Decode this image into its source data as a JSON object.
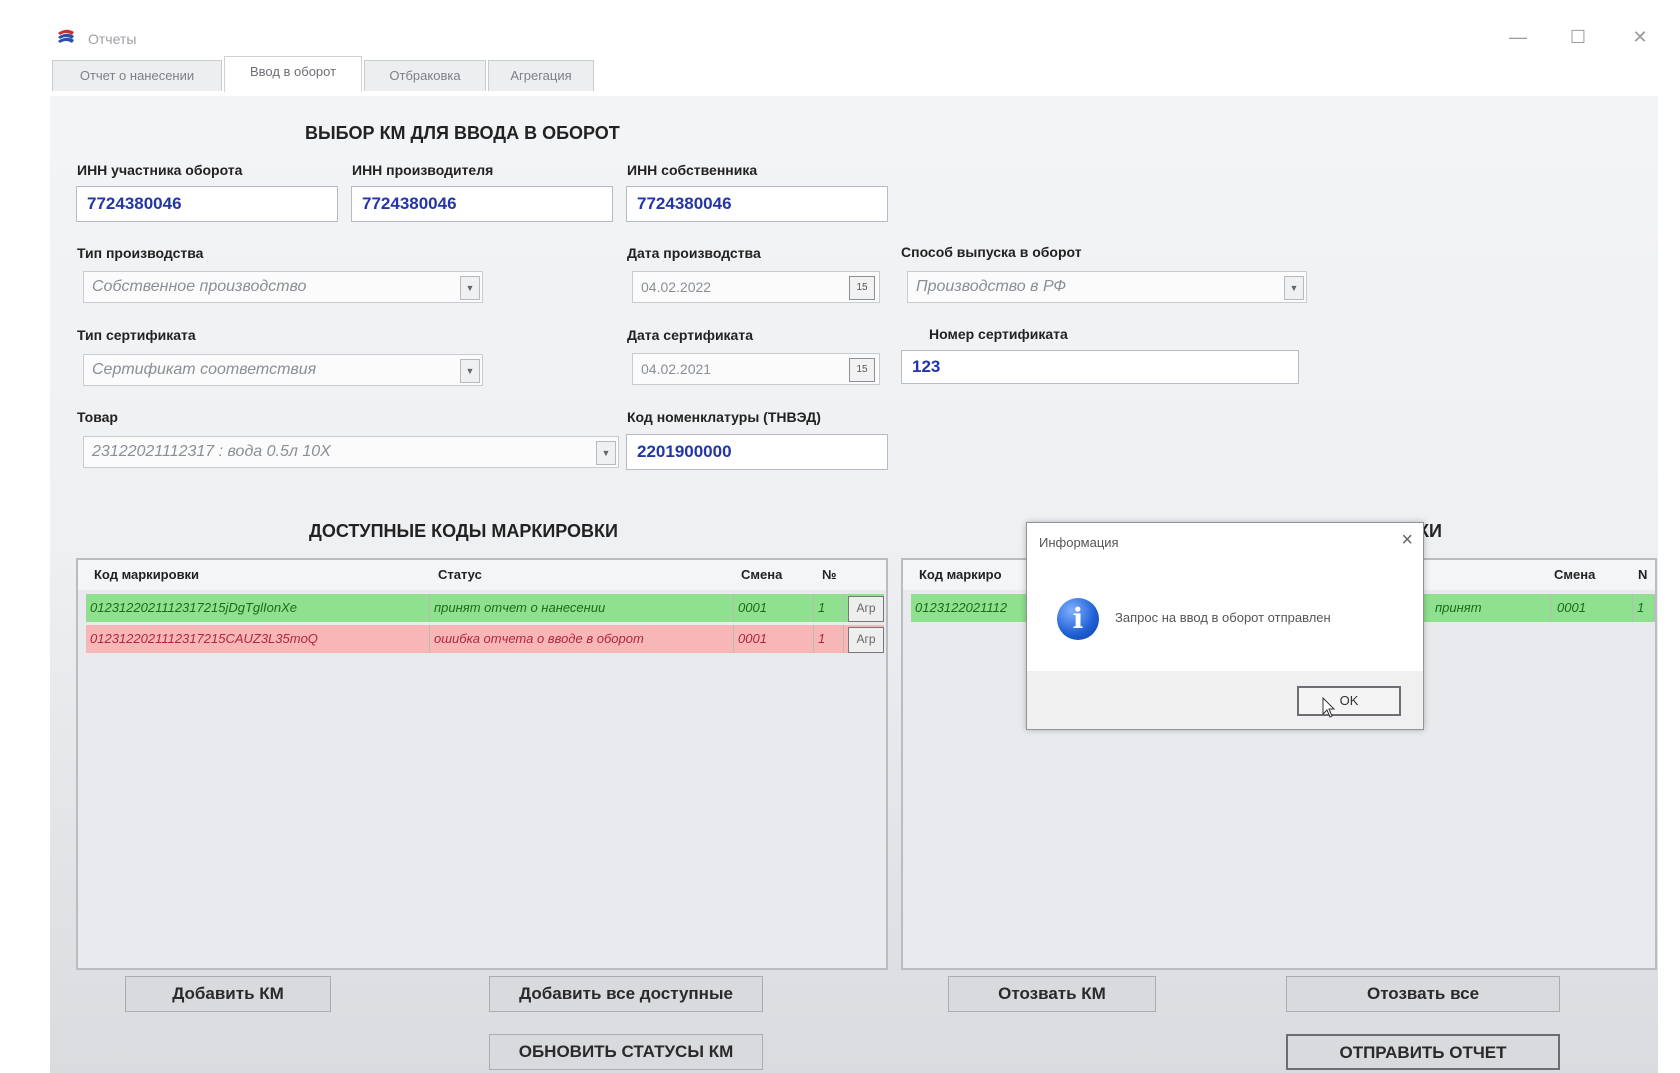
{
  "window": {
    "title": "Отчеты",
    "tabs": [
      "Отчет о нанесении",
      "Ввод в оборот",
      "Отбраковка",
      "Агрегация"
    ],
    "active_tab": "Ввод в оборот",
    "controls": {
      "minimize": "—",
      "maximize": "☐",
      "close": "✕"
    }
  },
  "form": {
    "heading": "ВЫБОР КМ ДЛЯ ВВОДА В ОБОРОТ",
    "inn_participant": {
      "label": "ИНН участника оборота",
      "value": "7724380046"
    },
    "inn_producer": {
      "label": "ИНН производителя",
      "value": "7724380046"
    },
    "inn_owner": {
      "label": "ИНН собственника",
      "value": "7724380046"
    },
    "production_type": {
      "label": "Тип производства",
      "value": "Собственное производство"
    },
    "production_date": {
      "label": "Дата производства",
      "value": "04.02.2022"
    },
    "release_method": {
      "label": "Способ выпуска в оборот",
      "value": "Производство в РФ"
    },
    "cert_type": {
      "label": "Тип сертификата",
      "value": "Сертификат соответствия"
    },
    "cert_date": {
      "label": "Дата сертификата",
      "value": "04.02.2021"
    },
    "cert_number": {
      "label": "Номер сертификата",
      "value": "123"
    },
    "product": {
      "label": "Товар",
      "value": "23122021112317 : вода 0.5л 10Х"
    },
    "tnved": {
      "label": "Код номенклатуры (ТНВЭД)",
      "value": "2201900000"
    }
  },
  "available": {
    "heading": "ДОСТУПНЫЕ КОДЫ МАРКИРОВКИ",
    "columns": [
      "Код маркировки",
      "Статус",
      "Смена",
      "№"
    ],
    "rows": [
      {
        "code": "0123122021112317215jDgTglIonXe",
        "status": "принят отчет о нанесении",
        "shift": "0001",
        "num": "1",
        "action": "Агр",
        "state": "green"
      },
      {
        "code": "0123122021112317215CAUZ3L35moQ",
        "status": "ошибка отчета о вводе в оборот",
        "shift": "0001",
        "num": "1",
        "action": "Агр",
        "state": "red"
      }
    ]
  },
  "selected": {
    "heading_visible": "КИ",
    "columns": [
      "Код маркиро",
      "Смена",
      "N"
    ],
    "rows": [
      {
        "code": "0123122021112",
        "status": "принят",
        "shift": "0001",
        "num": "1",
        "state": "green"
      }
    ]
  },
  "buttons": {
    "add_km": "Добавить КМ",
    "add_all": "Добавить все доступные",
    "recall_km": "Отозвать КМ",
    "recall_all": "Отозвать все",
    "refresh": "ОБНОВИТЬ СТАТУСЫ КМ",
    "send": "ОТПРАВИТЬ ОТЧЕТ"
  },
  "dialog": {
    "title": "Информация",
    "message": "Запрос на ввод в оборот отправлен",
    "ok": "OK",
    "icon": "info-icon"
  },
  "colors": {
    "row_ok": "#8fe08f",
    "row_error": "#f7b7b7",
    "value_text": "#2336a8"
  }
}
